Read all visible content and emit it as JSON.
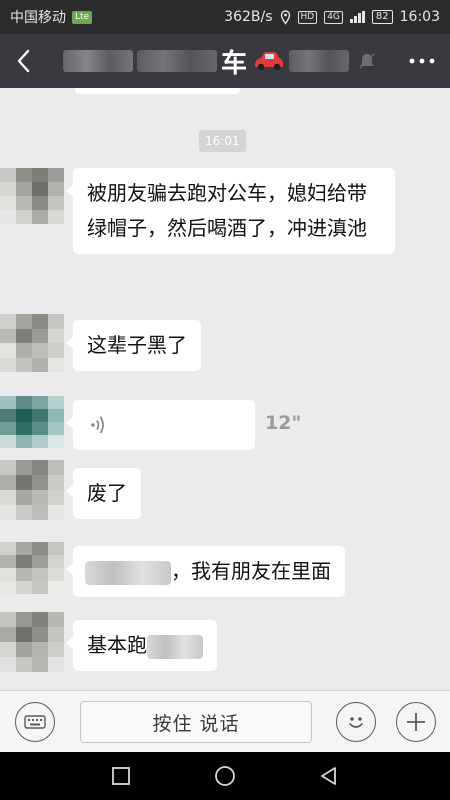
{
  "status": {
    "carrier": "中国移动",
    "carrier_badge": "Lte",
    "speed": "362B/s",
    "hd": "HD",
    "net": "4G",
    "battery": "82",
    "time": "16:03"
  },
  "header": {
    "title": "车",
    "icons": [
      "back-arrow-icon",
      "car-emoji-icon",
      "mute-icon",
      "more-icon"
    ]
  },
  "chat": {
    "timestamp": "16:01",
    "messages": [
      {
        "type": "text",
        "text": "被朋友骗去跑对公车，媳妇给带绿帽子，然后喝酒了，冲进滇池"
      },
      {
        "type": "text",
        "text": "这辈子黑了"
      },
      {
        "type": "voice",
        "duration": "12\""
      },
      {
        "type": "text",
        "text": "废了"
      },
      {
        "type": "text",
        "text": "，我有朋友在里面"
      },
      {
        "type": "text",
        "text": "基本跑"
      }
    ]
  },
  "input": {
    "hold_to_talk": "按住 说话",
    "icons": [
      "keyboard-icon",
      "emoji-icon",
      "plus-icon"
    ]
  },
  "nav": {
    "icons": [
      "recent-apps-icon",
      "home-icon",
      "back-icon"
    ]
  },
  "colors": {
    "title_bar": "#393a3f",
    "chat_bg": "#ebebeb",
    "bubble": "#ffffff"
  }
}
